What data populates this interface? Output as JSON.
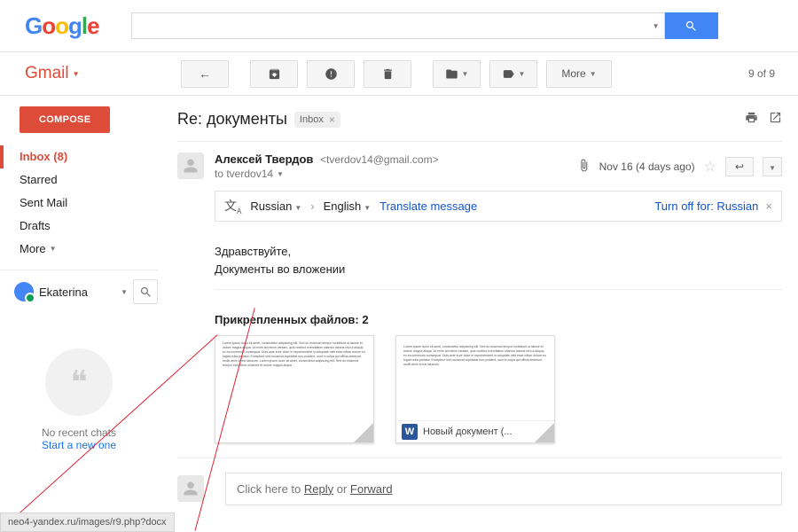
{
  "logo": {
    "g1": "G",
    "o1": "o",
    "o2": "o",
    "g2": "g",
    "l1": "l",
    "e1": "e"
  },
  "search": {
    "value": "",
    "placeholder": ""
  },
  "brand": "Gmail",
  "toolbar": {
    "more": "More",
    "counter": "9 of 9"
  },
  "compose": "COMPOSE",
  "nav": {
    "inbox": "Inbox (8)",
    "starred": "Starred",
    "sent": "Sent Mail",
    "drafts": "Drafts",
    "more": "More"
  },
  "account": {
    "name": "Ekaterina"
  },
  "hangouts": {
    "empty": "No recent chats",
    "cta": "Start a new one"
  },
  "subject": {
    "text": "Re: документы",
    "label": "Inbox"
  },
  "msg": {
    "from_name": "Алексей Твердов",
    "from_addr": "<tverdov14@gmail.com>",
    "to_line": "to tverdov14",
    "date": "Nov 16 (4 days ago)"
  },
  "translate": {
    "src": "Russian",
    "dst": "English",
    "cta": "Translate message",
    "off": "Turn off for: Russian"
  },
  "body": {
    "l1": "Здравствуйте,",
    "l2": "Документы во вложении"
  },
  "attachments": {
    "header": "Прикрепленных файлов: 2",
    "word_name": "Новый документ (..."
  },
  "replybox": {
    "prefix": "Click here to ",
    "reply": "Reply",
    "or": " or ",
    "fwd": "Forward"
  },
  "status_url": "neo4-yandex.ru/images/r9.php?docx"
}
